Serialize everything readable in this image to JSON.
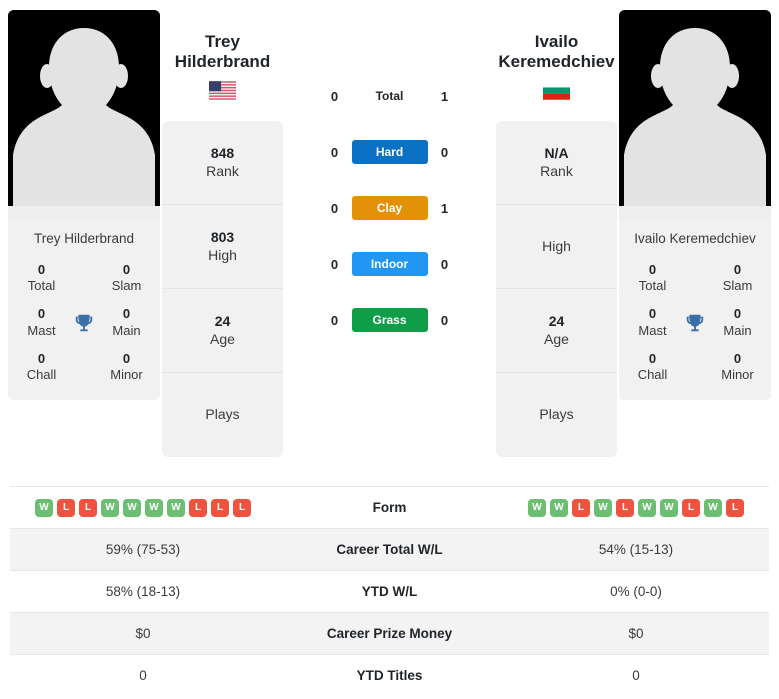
{
  "players": {
    "left": {
      "name": "Trey Hilderbrand",
      "name_line1": "Trey",
      "name_line2": "Hilderbrand",
      "card_name": "Trey Hilderbrand",
      "flag": "us-flag-icon",
      "country": "United States",
      "titles": [
        {
          "value": "0",
          "label": "Total"
        },
        {
          "value": "0",
          "label": "Slam"
        },
        {
          "value": "0",
          "label": "Mast"
        },
        {
          "value": "0",
          "label": "Main"
        },
        {
          "value": "0",
          "label": "Chall"
        },
        {
          "value": "0",
          "label": "Minor"
        }
      ],
      "stats": [
        {
          "value": "848",
          "label": "Rank"
        },
        {
          "value": "803",
          "label": "High"
        },
        {
          "value": "24",
          "label": "Age"
        },
        {
          "value": "",
          "label": "Plays"
        }
      ],
      "form": [
        "W",
        "L",
        "L",
        "W",
        "W",
        "W",
        "W",
        "L",
        "L",
        "L"
      ],
      "career_total_wl": "59% (75-53)",
      "ytd_wl": "58% (18-13)",
      "career_prize_money": "$0",
      "ytd_titles": "0"
    },
    "right": {
      "name": "Ivailo Keremedchiev",
      "name_line1": "Ivailo",
      "name_line2": "Keremedchiev",
      "card_name": "Ivailo Keremedchiev",
      "flag": "bulgaria-flag-icon",
      "country": "Bulgaria",
      "titles": [
        {
          "value": "0",
          "label": "Total"
        },
        {
          "value": "0",
          "label": "Slam"
        },
        {
          "value": "0",
          "label": "Mast"
        },
        {
          "value": "0",
          "label": "Main"
        },
        {
          "value": "0",
          "label": "Chall"
        },
        {
          "value": "0",
          "label": "Minor"
        }
      ],
      "stats": [
        {
          "value": "N/A",
          "label": "Rank"
        },
        {
          "value": "",
          "label": "High"
        },
        {
          "value": "24",
          "label": "Age"
        },
        {
          "value": "",
          "label": "Plays"
        }
      ],
      "form": [
        "W",
        "W",
        "L",
        "W",
        "L",
        "W",
        "W",
        "L",
        "W",
        "L"
      ],
      "career_total_wl": "54% (15-13)",
      "ytd_wl": "0% (0-0)",
      "career_prize_money": "$0",
      "ytd_titles": "0"
    }
  },
  "head_to_head": [
    {
      "label": "Total",
      "left": "0",
      "right": "1",
      "badge": false,
      "color": ""
    },
    {
      "label": "Hard",
      "left": "0",
      "right": "0",
      "badge": true,
      "color": "#0b71c4"
    },
    {
      "label": "Clay",
      "left": "0",
      "right": "1",
      "badge": true,
      "color": "#e39208"
    },
    {
      "label": "Indoor",
      "left": "0",
      "right": "0",
      "badge": true,
      "color": "#2196f3"
    },
    {
      "label": "Grass",
      "left": "0",
      "right": "0",
      "badge": true,
      "color": "#0f9d47"
    }
  ],
  "comparison_rows": [
    {
      "label": "Form",
      "type": "form"
    },
    {
      "label": "Career Total W/L",
      "type": "text",
      "key": "career_total_wl"
    },
    {
      "label": "YTD W/L",
      "type": "text",
      "key": "ytd_wl"
    },
    {
      "label": "Career Prize Money",
      "type": "text",
      "key": "career_prize_money"
    },
    {
      "label": "YTD Titles",
      "type": "text",
      "key": "ytd_titles"
    }
  ],
  "colors": {
    "win": "#6cbf72",
    "loss": "#ef5340",
    "trophy": "#3b6fa8",
    "card_bg": "#f1f1f1"
  },
  "icons": {
    "trophy": "trophy-icon"
  }
}
